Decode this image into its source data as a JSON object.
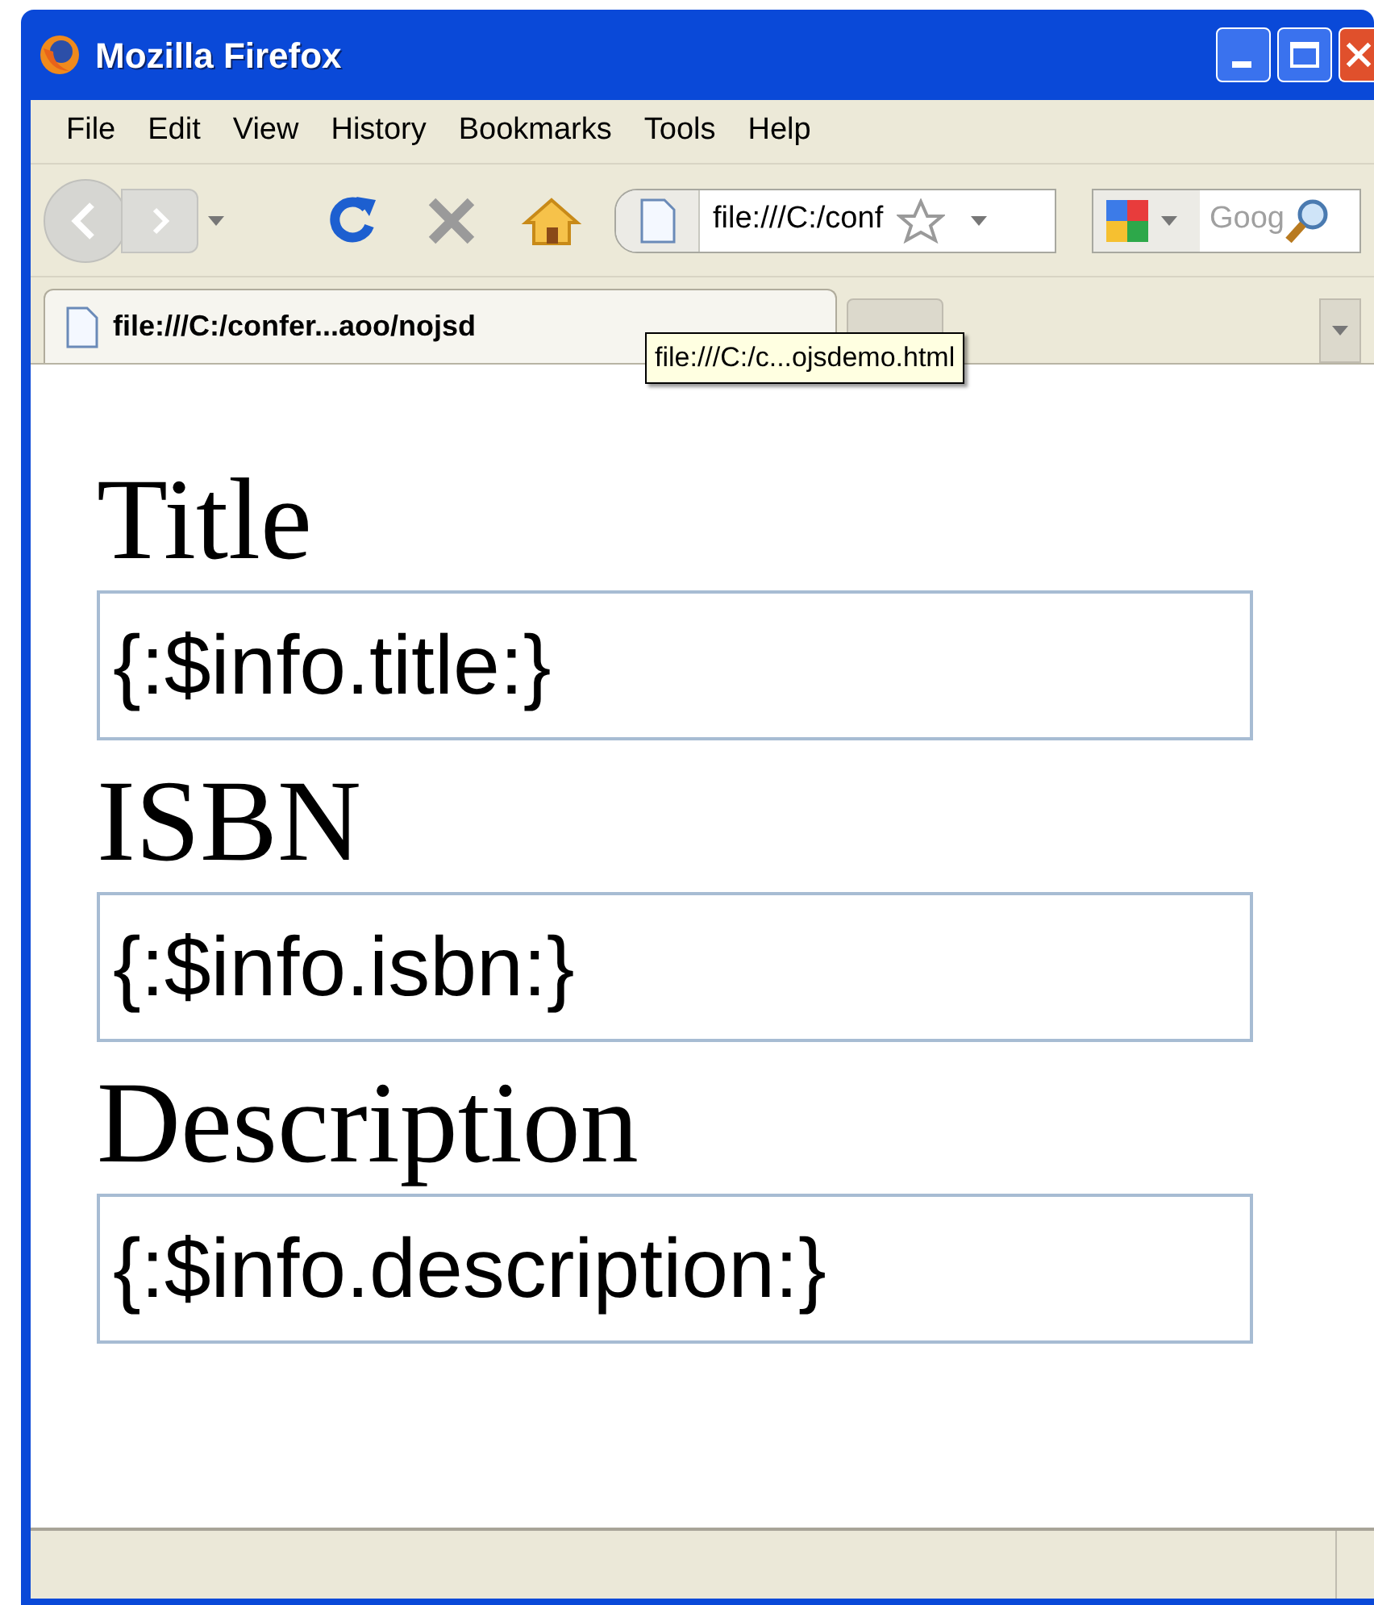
{
  "window": {
    "title": "Mozilla Firefox"
  },
  "menu": [
    "File",
    "Edit",
    "View",
    "History",
    "Bookmarks",
    "Tools",
    "Help"
  ],
  "toolbar": {
    "address": "file:///C:/conf",
    "search_placeholder": "Goog"
  },
  "tabs": [
    {
      "label": "file:///C:/confer...aoo/nojsd",
      "selected": true
    }
  ],
  "tooltip": "file:///C:/c...ojsdemo.html",
  "form": [
    {
      "label": "Title",
      "value": "{:$info.title:}"
    },
    {
      "label": "ISBN",
      "value": "{:$info.isbn:}"
    },
    {
      "label": "Description",
      "value": "{:$info.description:}"
    }
  ]
}
